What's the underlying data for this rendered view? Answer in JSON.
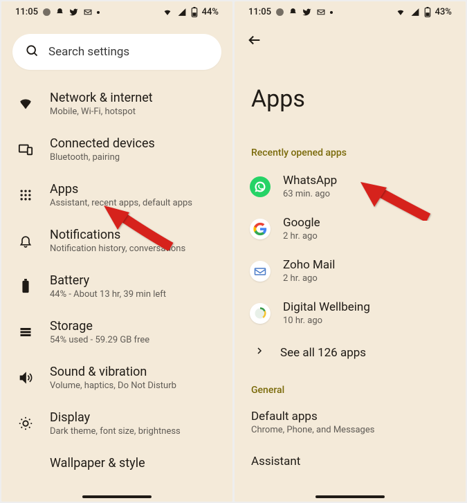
{
  "left": {
    "status": {
      "time": "11:05",
      "battery": "44%"
    },
    "search": {
      "placeholder": "Search settings"
    },
    "items": [
      {
        "title": "Network & internet",
        "sub": "Mobile, Wi-Fi, hotspot"
      },
      {
        "title": "Connected devices",
        "sub": "Bluetooth, pairing"
      },
      {
        "title": "Apps",
        "sub": "Assistant, recent apps, default apps"
      },
      {
        "title": "Notifications",
        "sub": "Notification history, conversations"
      },
      {
        "title": "Battery",
        "sub": "44% - About 13 hr, 39 min left"
      },
      {
        "title": "Storage",
        "sub": "54% used - 59.29 GB free"
      },
      {
        "title": "Sound & vibration",
        "sub": "Volume, haptics, Do Not Disturb"
      },
      {
        "title": "Display",
        "sub": "Dark theme, font size, brightness"
      },
      {
        "title": "Wallpaper & style",
        "sub": ""
      }
    ]
  },
  "right": {
    "status": {
      "time": "11:05",
      "battery": "43%"
    },
    "page_title": "Apps",
    "section1": "Recently opened apps",
    "apps": [
      {
        "name": "WhatsApp",
        "sub": "63 min. ago"
      },
      {
        "name": "Google",
        "sub": "2 hr. ago"
      },
      {
        "name": "Zoho Mail",
        "sub": "2 hr. ago"
      },
      {
        "name": "Digital Wellbeing",
        "sub": "10 hr. ago"
      }
    ],
    "see_all": "See all 126 apps",
    "section2": "General",
    "default_apps": {
      "title": "Default apps",
      "sub": "Chrome, Phone, and Messages"
    },
    "assistant": {
      "title": "Assistant"
    }
  }
}
